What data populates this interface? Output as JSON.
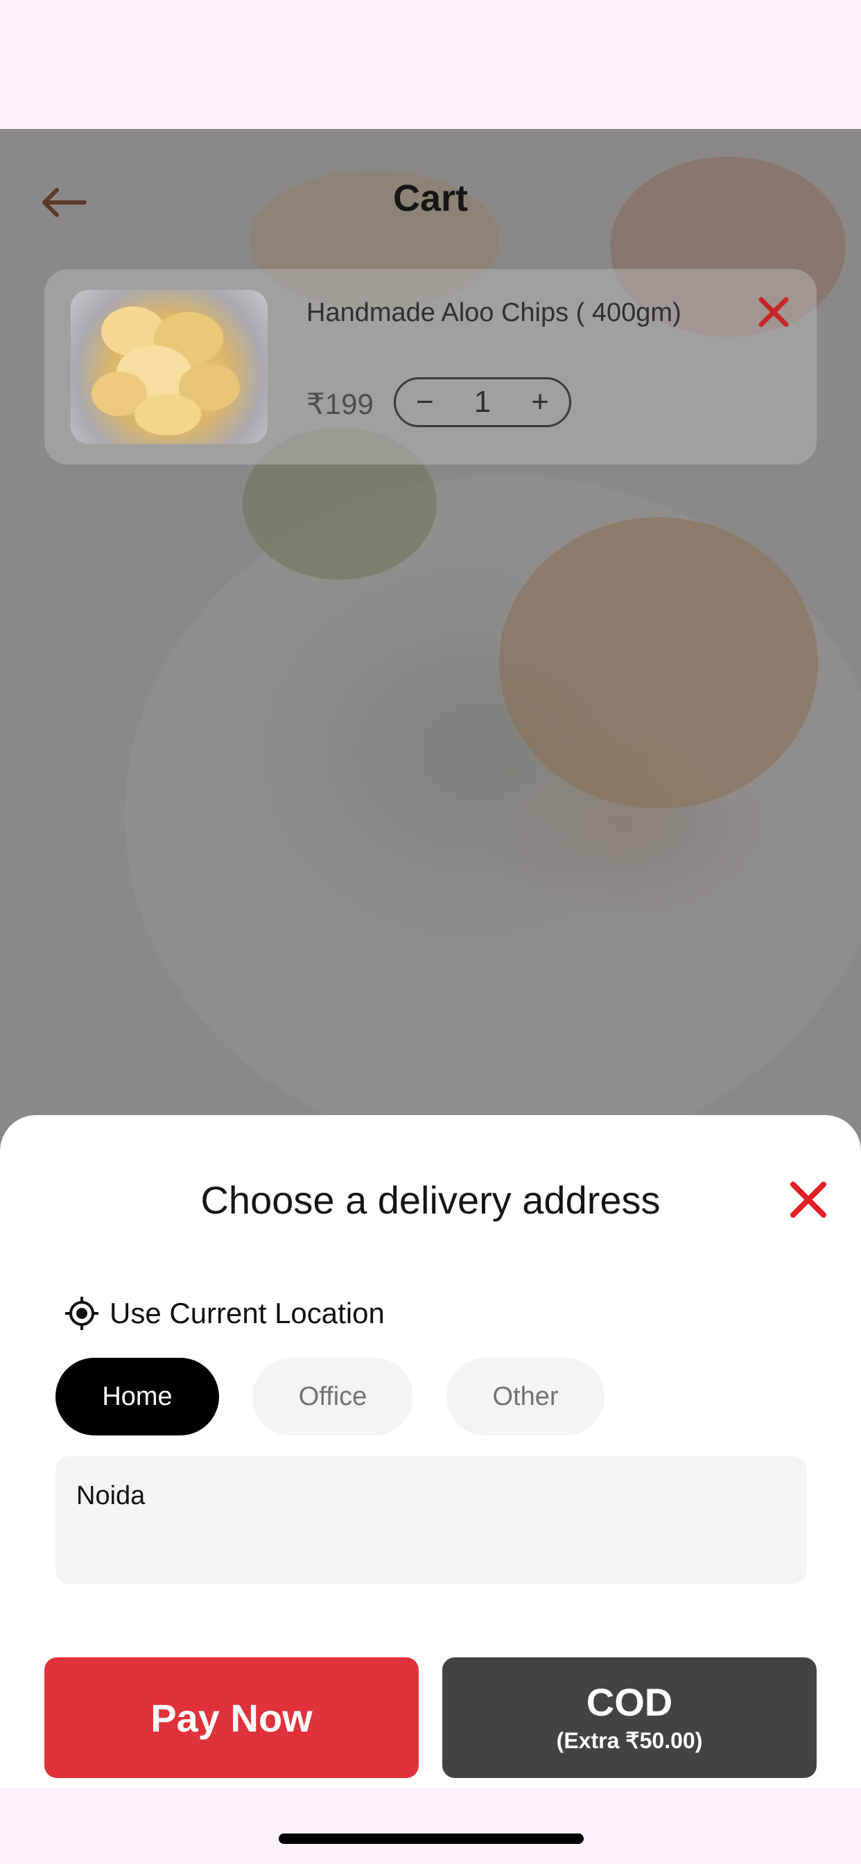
{
  "header": {
    "title": "Cart"
  },
  "cart": {
    "item": {
      "name": "Handmade Aloo Chips ( 400gm)",
      "price": "₹199",
      "quantity": "1",
      "decrement": "−",
      "increment": "+"
    }
  },
  "sheet": {
    "title": "Choose a delivery address",
    "use_location_label": "Use Current Location",
    "address_types": [
      "Home",
      "Office",
      "Other"
    ],
    "selected_type": "Home",
    "address_value": "Noida"
  },
  "actions": {
    "pay_now_label": "Pay Now",
    "cod_label": "COD",
    "cod_extra": "(Extra ₹50.00)"
  },
  "colors": {
    "accent_red": "#e0323a",
    "close_red": "#e31e24",
    "cod_dark": "#434343",
    "active_chip": "#000000"
  },
  "icons": {
    "back": "arrow-left-icon",
    "remove": "close-icon",
    "location": "crosshair-location-icon",
    "sheet_close": "close-icon"
  }
}
